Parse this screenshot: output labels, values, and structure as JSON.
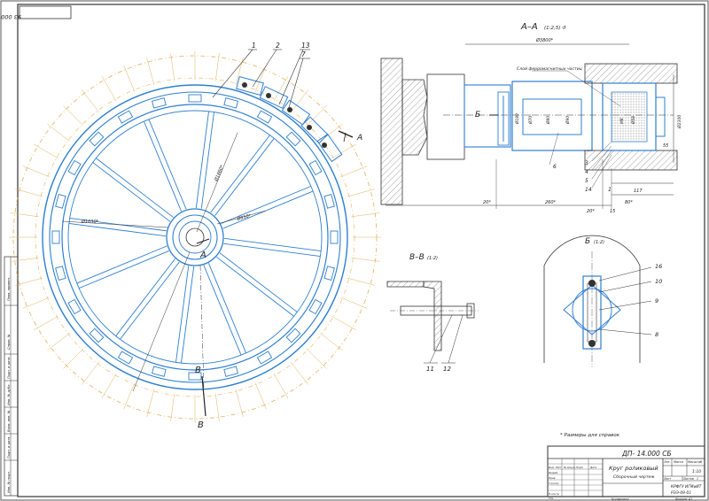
{
  "colors": {
    "paper": "#ffffff",
    "ink": "#333333",
    "part_lines": "#2f7fd0",
    "axis_lines": "#e3b15a"
  },
  "stamp_topleft": "93 000 ΊΊ  ' ' -ΊΠ",
  "main_view": {
    "leaders": [
      "1",
      "2",
      "13",
      "7"
    ],
    "dims": {
      "d_outer": "Ø1030*",
      "d_mid": "Ø1860*",
      "d_inner": "Ø850*"
    },
    "section_A_mark": "A",
    "section_A_arrow": "A",
    "center_A": "A",
    "section_B_top": "B",
    "section_B_bottom": "B"
  },
  "section_AA": {
    "title": "A–A",
    "scale": "(1:2,5) ↺",
    "dim_top": "Ø3800*",
    "label_layer": "Слой ферромагнитных частиц",
    "view_B_arrow": "Б",
    "dims_inner": [
      "Ø180",
      "Ø70",
      "Ø80",
      "Ø90"
    ],
    "dims_right": [
      "M8",
      "Ø58"
    ],
    "dim_2300": "Ø2300",
    "dim_55": "55",
    "dim_117": "117",
    "dim_80": "80*",
    "dim_20a": "20*",
    "dim_260": "260*",
    "dim_20b": "20*",
    "dim_15": "15",
    "part_labels_left": [
      "3",
      "4",
      "5",
      "14"
    ],
    "part_label_6": "6",
    "part_label_1": "1"
  },
  "section_BB": {
    "title": "В–В",
    "scale": "(1:2)",
    "parts": [
      "11",
      "12"
    ]
  },
  "view_B": {
    "title": "Б",
    "scale": "(1:2)",
    "parts": [
      "16",
      "10",
      "9",
      "8"
    ]
  },
  "note": "* Размеры для справок",
  "title_block": {
    "doc_number": "ДП-     14.000 СБ",
    "name": "Круг роликовый",
    "subtitle": "Сборочный чертеж",
    "lit_header": "Лит.",
    "mass_header": "Масса",
    "scale_header": "Масштаб",
    "scale_value": "1:10",
    "sheet_label": "Лист",
    "sheets_label": "Листов",
    "sheets_value": "1",
    "org_line1": "КРФГУ ИГМиИТ",
    "org_line2": "РЭЭ-09-01",
    "rows": [
      "Изм. Лист",
      "№ докум.",
      "Подп.",
      "Дата"
    ],
    "roles": [
      "Разраб.",
      "Пров.",
      "Т.контр.",
      "",
      "Н.контр.",
      "Утв."
    ],
    "copy_label": "Копировал",
    "format_label": "Формат  А1"
  },
  "side_strip": [
    "Перв. примен.",
    "Справ. №",
    "Подп. и дата",
    "Инв. № дубл.",
    "Взам. инв. №",
    "Подп. и дата",
    "Инв. № подл."
  ]
}
